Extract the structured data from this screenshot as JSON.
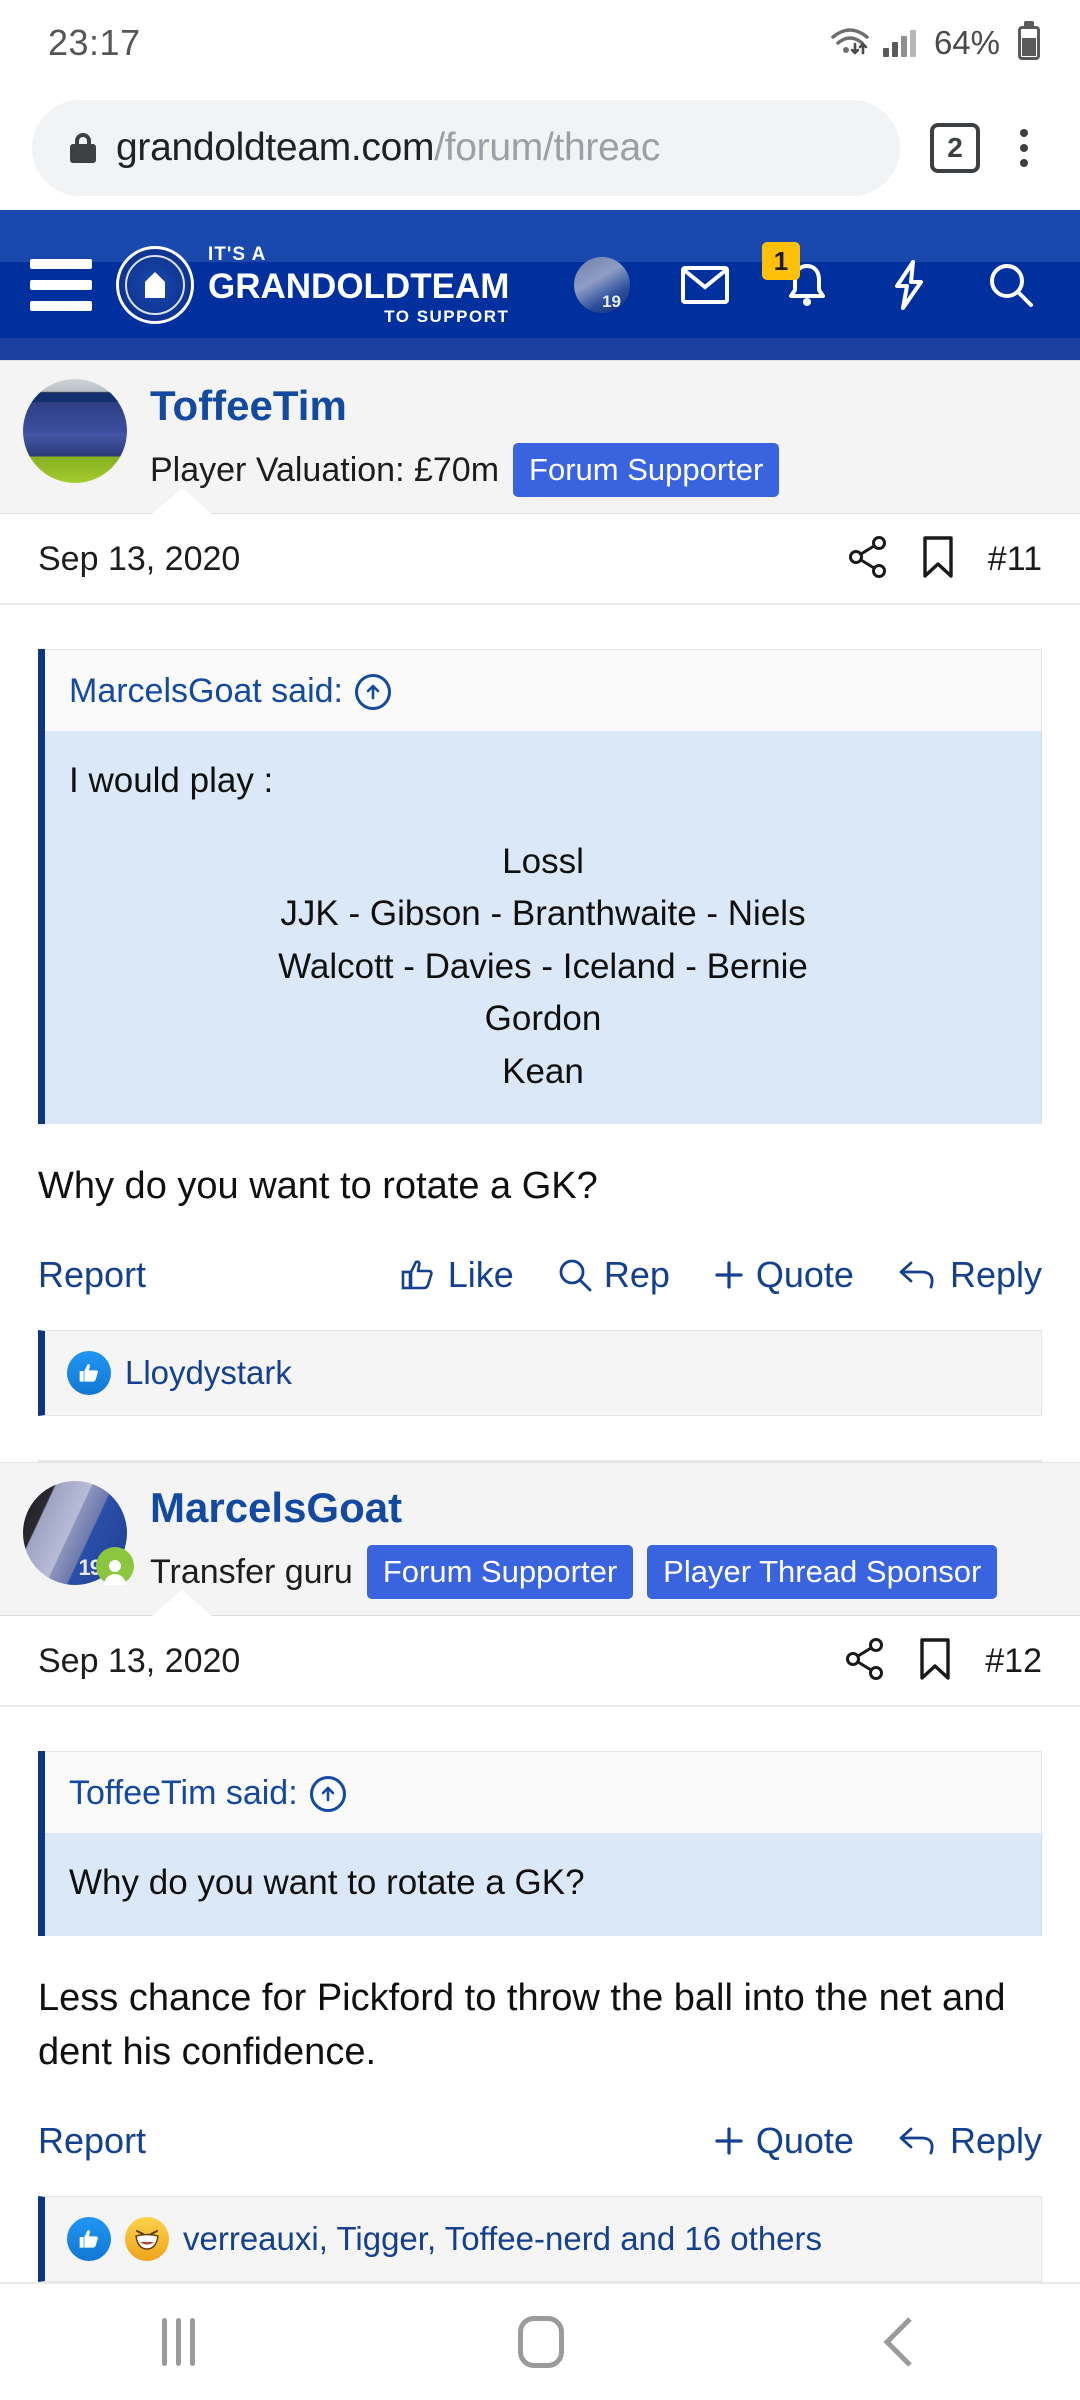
{
  "status_bar": {
    "time": "23:17",
    "battery": "64%",
    "wifi_icon": "wifi-icon",
    "signal_icon": "cellular-signal-icon",
    "battery_icon": "battery-icon"
  },
  "browser": {
    "lock_icon": "lock-icon",
    "url_domain": "grandoldteam.com",
    "url_path": "/forum/threac",
    "tab_count": "2",
    "menu_icon": "kebab-menu-icon"
  },
  "site_header": {
    "menu_icon": "hamburger-menu-icon",
    "logo": {
      "line1": "IT'S A",
      "line2": "GRANDOLDTEAM",
      "line3": "TO SUPPORT",
      "crest_icon": "crest-icon"
    },
    "avatar_icon": "user-avatar",
    "inbox_icon": "envelope-icon",
    "alerts_icon": "bell-icon",
    "alerts_badge": "1",
    "whats_new_icon": "lightning-bolt-icon",
    "search_icon": "search-icon"
  },
  "posts": [
    {
      "username": "ToffeeTim",
      "user_title": "Player Valuation: £70m",
      "badges": [
        "Forum Supporter"
      ],
      "avatar_icon": "stadium-avatar",
      "online": false,
      "date": "Sep 13, 2020",
      "share_icon": "share-icon",
      "bookmark_icon": "bookmark-icon",
      "post_number": "#11",
      "quote": {
        "author_said": "MarcelsGoat said:",
        "jump_icon": "jump-to-post-icon",
        "intro": "I would play :",
        "lines": [
          "Lossl",
          "JJK - Gibson - Branthwaite - Niels",
          "Walcott - Davies - Iceland - Bernie",
          "Gordon",
          "Kean"
        ]
      },
      "body": "Why do you want to rotate a GK?",
      "actions": {
        "report": "Report",
        "like": "Like",
        "rep": "Rep",
        "quote": "Quote",
        "reply": "Reply",
        "like_icon": "thumbs-up-icon",
        "rep_icon": "magnifier-icon",
        "quote_icon": "plus-icon",
        "reply_icon": "reply-arrow-icon"
      },
      "reactions": {
        "icons": [
          "like-reaction-icon"
        ],
        "names": "Lloydystark"
      }
    },
    {
      "username": "MarcelsGoat",
      "user_title": "Transfer guru",
      "badges": [
        "Forum Supporter",
        "Player Thread Sponsor"
      ],
      "avatar_icon": "press-conference-avatar",
      "online": true,
      "date": "Sep 13, 2020",
      "share_icon": "share-icon",
      "bookmark_icon": "bookmark-icon",
      "post_number": "#12",
      "quote": {
        "author_said": "ToffeeTim said:",
        "jump_icon": "jump-to-post-icon",
        "intro": "Why do you want to rotate a GK?",
        "lines": []
      },
      "body": "Less chance for Pickford to throw the ball into the net and dent his confidence.",
      "actions": {
        "report": "Report",
        "quote": "Quote",
        "reply": "Reply",
        "quote_icon": "plus-icon",
        "reply_icon": "reply-arrow-icon"
      },
      "reactions": {
        "icons": [
          "like-reaction-icon",
          "haha-reaction-icon"
        ],
        "names": "verreauxi, Tigger, Toffee-nerd and 16 others"
      }
    }
  ],
  "nav_bar": {
    "recents_icon": "recents-icon",
    "home_icon": "home-icon",
    "back_icon": "back-icon"
  },
  "colors": {
    "header_blue": "#00309e",
    "link_blue": "#134aa0",
    "badge_blue": "#3a63e0",
    "quote_bg": "#dbe8f7",
    "alert_badge": "#ffc107",
    "online_green": "#8cc63f"
  }
}
